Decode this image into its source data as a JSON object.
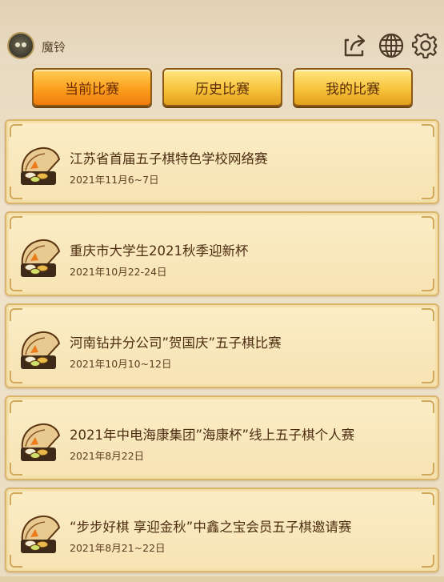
{
  "header": {
    "username": "魔铃",
    "icons": [
      "share-icon",
      "globe-icon",
      "gear-icon"
    ]
  },
  "tabs": [
    {
      "label": "当前比赛",
      "active": true
    },
    {
      "label": "历史比赛",
      "active": false
    },
    {
      "label": "我的比赛",
      "active": false
    }
  ],
  "competitions": [
    {
      "title": "江苏省首届五子棋特色学校网络赛",
      "date": "2021年11月6~7日"
    },
    {
      "title": "重庆市大学生2021秋季迎新杯",
      "date": "2021年10月22-24日"
    },
    {
      "title": "河南钻井分公司”贺国庆”五子棋比赛",
      "date": "2021年10月10~12日"
    },
    {
      "title": "2021年中电海康集团”海康杯”线上五子棋个人赛",
      "date": "2021年8月22日"
    },
    {
      "title": "“步步好棋 享迎金秋”中鑫之宝会员五子棋邀请赛",
      "date": "2021年8月21~22日"
    }
  ],
  "colors": {
    "tab_active": "#f7941d",
    "tab_inactive": "#f7c33c",
    "card_bg": "#f9e8bd",
    "text_dark": "#4d2d12"
  }
}
